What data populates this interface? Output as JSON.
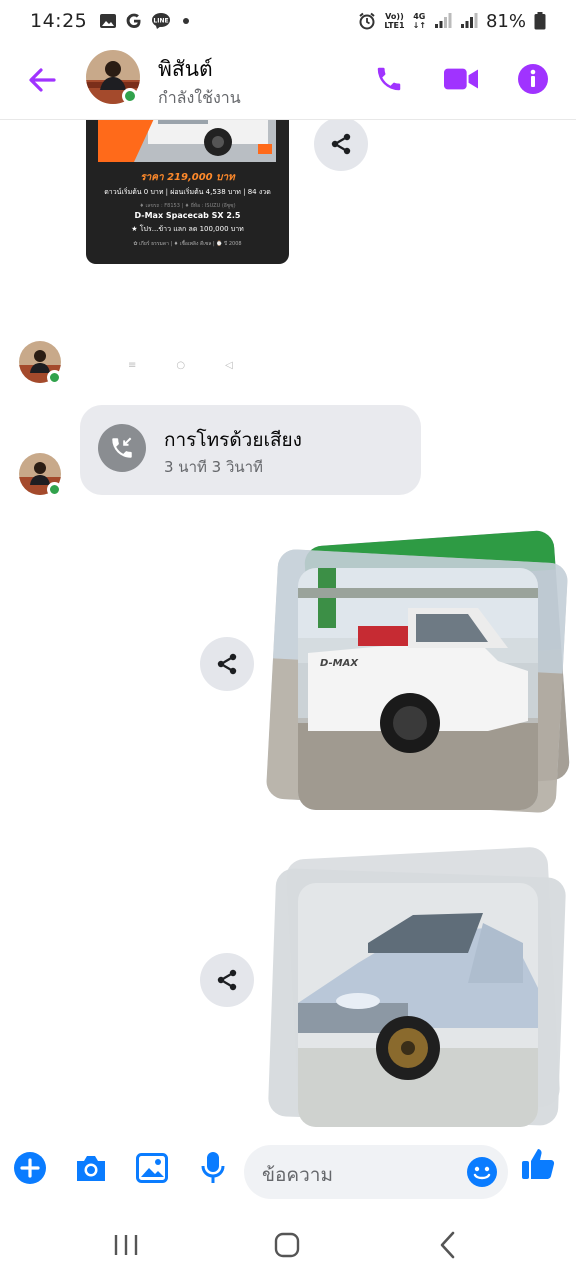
{
  "status_bar": {
    "time": "14:25",
    "network_top": "Vo))",
    "network_bottom": "LTE1",
    "net_type": "4G",
    "battery": "81%"
  },
  "header": {
    "contact_name": "พิสันต์",
    "presence": "กำลังใช้งาน",
    "accent_color": "#a033ff"
  },
  "shared_post": {
    "price": "ราคา 219,000 บาท",
    "down_payment": "ดาวน์เริ่มต้น 0 บาท | ผ่อนเริ่มต้น 4,538 บาท | 84 งวด",
    "specs": "♦ เลขรถ : F8153 | ♦ ยี่ห้อ : ISUZU (อีซูซุ)",
    "model": "D-Max Spacecab SX 2.5",
    "promo": "★ โปร...ข้าว แลก ลด 100,000 บาท",
    "footer": "✿ เกียร์ ธรรมดา | ♦ เชื้อเพลิง ดีเซล | ⌚ ปี 2008"
  },
  "call_message": {
    "title": "การโทรด้วยเสียง",
    "duration": "3 นาที 3 วินาที"
  },
  "composer": {
    "placeholder": "ข้อความ"
  },
  "icons": {
    "back": "back-arrow-icon",
    "call": "phone-icon",
    "video": "video-icon",
    "info": "info-icon",
    "share": "share-icon",
    "add": "plus-icon",
    "camera": "camera-icon",
    "gallery": "image-icon",
    "mic": "microphone-icon",
    "emoji": "emoji-icon",
    "like": "thumbs-up-icon"
  },
  "colors": {
    "messenger_blue": "#0a7cff",
    "online_green": "#31a24c",
    "bubble_gray": "#e9eaee"
  }
}
